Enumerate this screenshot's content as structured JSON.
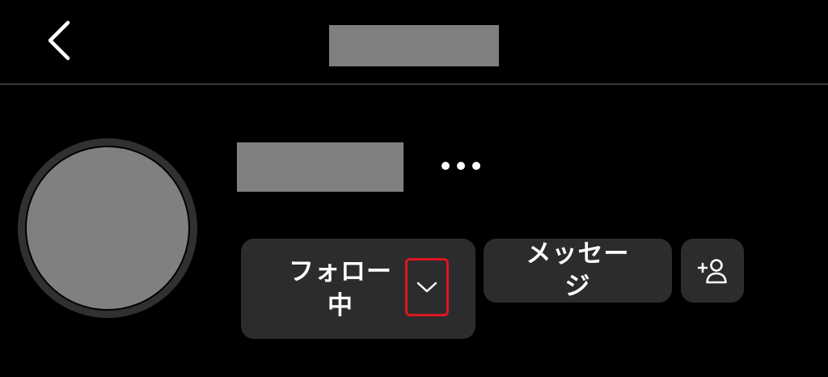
{
  "header": {
    "back_icon": "chevron-left-icon",
    "title": ""
  },
  "profile": {
    "username": "",
    "more_icon": "more-dots-icon"
  },
  "actions": {
    "follow": {
      "label_line1": "フォロー",
      "label_line2": "中",
      "dropdown_icon": "chevron-down-icon",
      "highlight_color": "#e01520"
    },
    "message": {
      "label_line1": "メッセー",
      "label_line2": "ジ"
    },
    "add_user_icon": "add-user-icon"
  },
  "colors": {
    "background": "#000000",
    "button": "#2c2c2e",
    "redacted": "#808080",
    "divider": "#3a3a3a"
  }
}
